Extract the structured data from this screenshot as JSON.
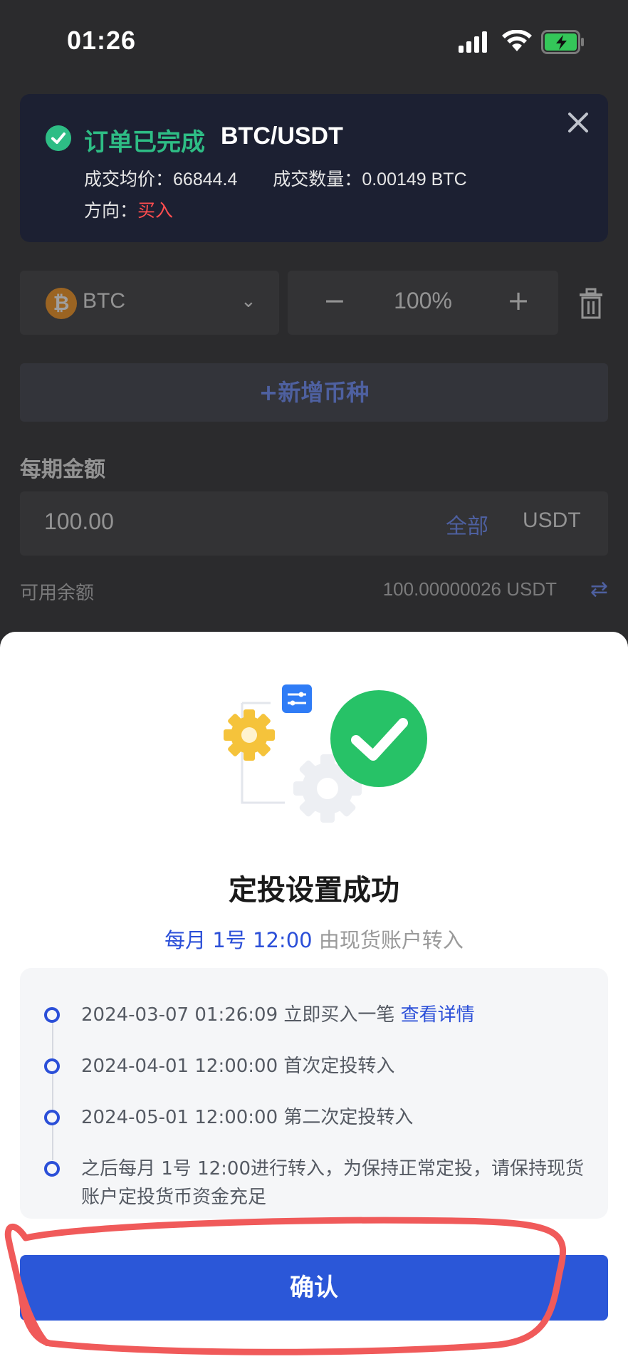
{
  "status_bar": {
    "time": "01:26"
  },
  "background": {
    "coin_label": "BTC",
    "ratio": "100%",
    "add_coin_label": "+新增币种",
    "amount_title": "每期金额",
    "amount_value": "100.00",
    "all_label": "全部",
    "currency": "USDT",
    "available_label": "可用余额",
    "available_value": "100.00000026 USDT"
  },
  "toast": {
    "title": "订单已完成",
    "pair": "BTC/USDT",
    "avg_price_label": "成交均价：",
    "avg_price": "66844.4",
    "qty_label": "成交数量：",
    "qty": "0.00149 BTC",
    "direction_label": "方向：",
    "direction": "买入"
  },
  "sheet": {
    "title": "定投设置成功",
    "schedule": "每月 1号 12:00",
    "schedule_source": "由现货账户转入",
    "timeline": [
      {
        "text": "2024-03-07 01:26:09 立即买入一笔",
        "link": "查看详情"
      },
      {
        "text": "2024-04-01 12:00:00 首次定投转入"
      },
      {
        "text": "2024-05-01 12:00:00 第二次定投转入"
      },
      {
        "text": "之后每月 1号 12:00进行转入，为保持正常定投，请保持现货账户定投货币资金充足"
      }
    ],
    "confirm_label": "确认"
  },
  "colors": {
    "accent": "#2b57d8",
    "success": "#2ebd85",
    "buy_red": "#ff4d4f",
    "annotation_red": "#f05a5a"
  }
}
